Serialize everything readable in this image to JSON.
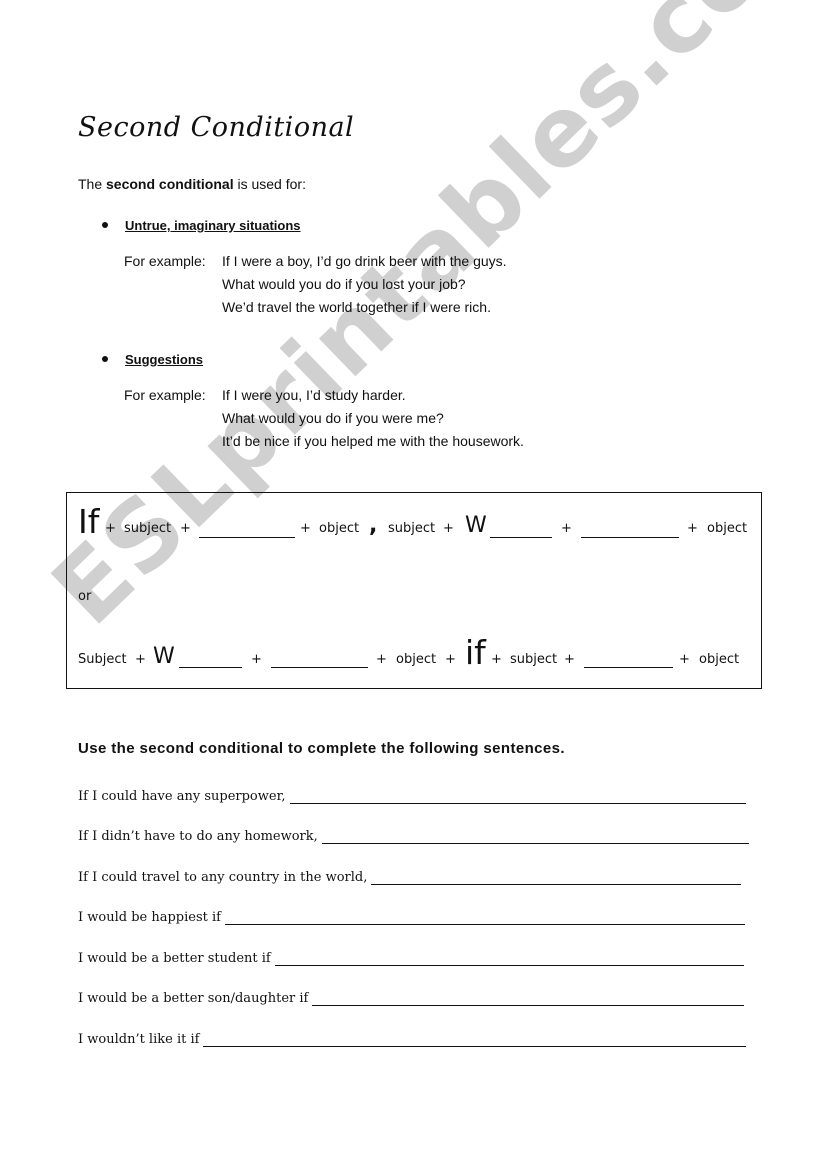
{
  "watermark": "ESLprintables.com",
  "title": "Second Conditional",
  "intro": {
    "prefix": "The ",
    "bold": "second conditional",
    "suffix": " is used for:"
  },
  "uses": [
    {
      "label": "Untrue, imaginary situations",
      "example_label": "For example:",
      "examples": [
        "If I were a boy, I’d go drink beer with the guys.",
        "What would you do if you lost your job?",
        "We’d travel the world together if I were rich."
      ]
    },
    {
      "label": "Suggestions",
      "example_label": "For example:",
      "examples": [
        "If I were you, I’d study harder.",
        "What would you do if you were me?",
        "It’d be nice if you helped me with the housework."
      ]
    }
  ],
  "formula": {
    "line1": {
      "if": "If",
      "plus": "+",
      "subject": "subject",
      "object": "object",
      "comma": ",",
      "w": "W"
    },
    "or": "or",
    "line2": {
      "subject_cap": "Subject",
      "plus": "+",
      "w": "W",
      "object": "object",
      "if": "if",
      "subject": "subject"
    }
  },
  "exercise": {
    "heading": "Use the second conditional to complete the following sentences.",
    "sentences": [
      "If I could have any superpower,",
      "If I didn’t have to do any homework,",
      "If I could travel to any country in the world,",
      "I would be happiest if",
      "I would be a better student if",
      "I would be a better son/daughter if",
      "I wouldn’t like it if"
    ]
  }
}
